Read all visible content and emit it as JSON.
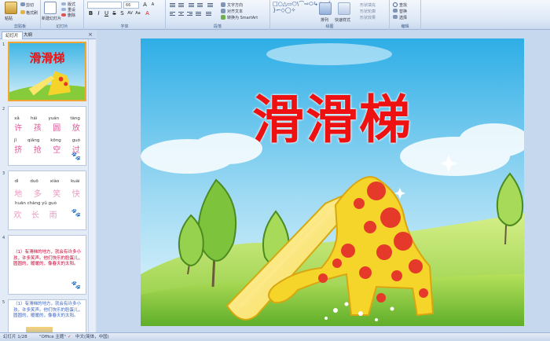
{
  "ribbon": {
    "clipboard": {
      "paste_label": "粘贴",
      "cut_label": "剪切",
      "format_painter_label": "格式刷",
      "group_label": "剪贴板"
    },
    "slides": {
      "new_slide_label": "新建幻灯片",
      "layout_label": "版式",
      "reset_label": "重设",
      "delete_label": "删除",
      "group_label": "幻灯片"
    },
    "font": {
      "font_name": "",
      "font_size": "66",
      "group_label": "字体"
    },
    "paragraph": {
      "text_direction_label": "文字方向",
      "align_text_label": "对齐文本",
      "smartart_label": "转换为 SmartArt",
      "group_label": "段落"
    },
    "drawing": {
      "arrange_label": "排列",
      "quick_styles_label": "快速样式",
      "shape_fill_label": "形状填充",
      "shape_outline_label": "形状轮廓",
      "shape_effects_label": "形状效果",
      "group_label": "绘图"
    },
    "editing": {
      "find_label": "查找",
      "replace_label": "替换",
      "select_label": "选择",
      "group_label": "编辑"
    }
  },
  "left_panel": {
    "tabs": [
      "幻灯片",
      "大纲"
    ],
    "slides": [
      {
        "number": "1",
        "title": "滑滑梯"
      },
      {
        "number": "2",
        "pinyin": [
          "xǎ",
          "hái",
          "yuán",
          "tàng",
          "jǐ",
          "qiǎng",
          "kōng",
          "guò"
        ],
        "chars": [
          "许",
          "孩",
          "圆",
          "放",
          "挤",
          "抢",
          "空",
          "过"
        ]
      },
      {
        "number": "3",
        "pinyin": [
          "dì",
          "duō",
          "xiào",
          "kuài",
          "huān chàng yǔ guò"
        ],
        "chars": [
          "地",
          "多",
          "笑",
          "快",
          "欢",
          "长",
          "雨"
        ]
      },
      {
        "number": "4",
        "text": "（1）有滑梯的地方，就会有许多小孩，许多笑声。他们快乐的脸蛋儿，圆圆的，暖暖的，像春天的太阳。"
      },
      {
        "number": "5",
        "text": "（1）有滑梯的地方，就会有许多小孩，许多笑声。他们快乐的脸蛋儿，圆圆的，暖暖的，像春天的太阳。"
      }
    ]
  },
  "slide": {
    "title": "滑滑梯"
  },
  "status_bar": {
    "slide_counter": "幻灯片 1/28",
    "theme": "\"Office 主题\"",
    "language": "中文(简体，中国)"
  },
  "colors": {
    "title": "#ee1111",
    "thumb_pink": "#e0569a",
    "selection": "#f2a735"
  }
}
